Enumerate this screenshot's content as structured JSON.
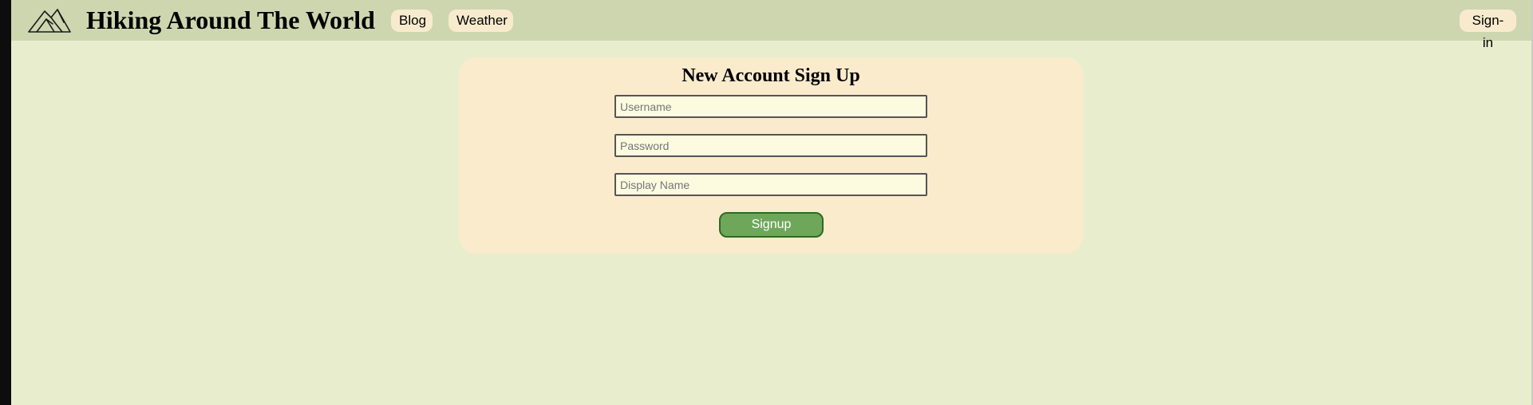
{
  "header": {
    "logo_icon": "mountain-icon",
    "site_title": "Hiking Around The World",
    "nav": {
      "blog_label": "Blog",
      "weather_label": "Weather"
    },
    "signin_label": "Sign-in"
  },
  "signup_form": {
    "title": "New Account Sign Up",
    "username": {
      "placeholder": "Username",
      "value": ""
    },
    "password": {
      "placeholder": "Password",
      "value": ""
    },
    "display_name": {
      "placeholder": "Display Name",
      "value": ""
    },
    "submit_label": "Signup"
  },
  "colors": {
    "page_background": "#e8eecd",
    "header_background": "#ced6b0",
    "card_background": "#faebcc",
    "nav_button_background": "#f8ebcd",
    "signup_button": "#6fa75a",
    "signup_button_border": "#2f6a1e",
    "input_background": "#fcfadf"
  }
}
